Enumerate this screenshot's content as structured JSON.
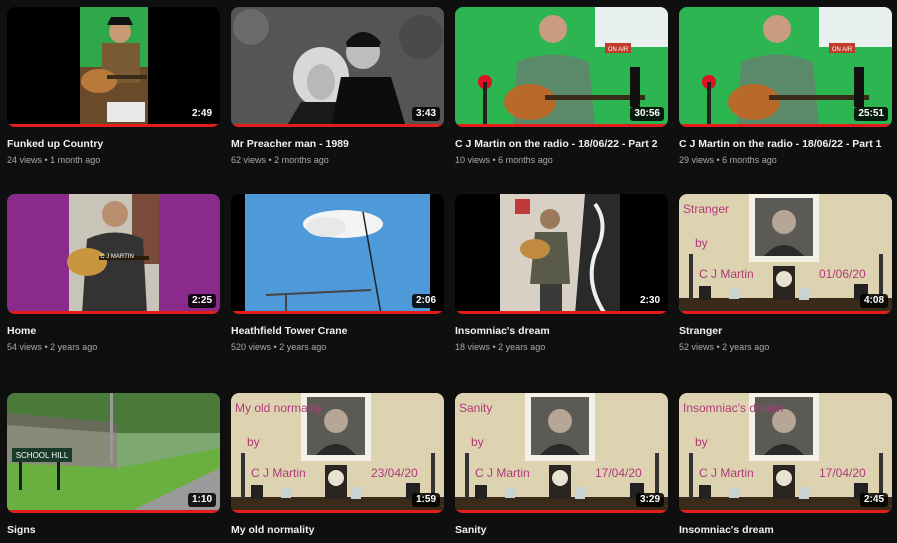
{
  "videos": [
    {
      "title": "Funked up Country",
      "views": "24 views",
      "age": "1 month ago",
      "duration": "2:49"
    },
    {
      "title": "Mr Preacher man - 1989",
      "views": "62 views",
      "age": "2 months ago",
      "duration": "3:43"
    },
    {
      "title": "C J Martin on the radio - 18/06/22 - Part 2",
      "views": "10 views",
      "age": "6 months ago",
      "duration": "30:56"
    },
    {
      "title": "C J Martin on the radio - 18/06/22 - Part 1",
      "views": "29 views",
      "age": "6 months ago",
      "duration": "25:51"
    },
    {
      "title": "Home",
      "views": "54 views",
      "age": "2 years ago",
      "duration": "2:25"
    },
    {
      "title": "Heathfield Tower Crane",
      "views": "520 views",
      "age": "2 years ago",
      "duration": "2:06"
    },
    {
      "title": "Insomniac's dream",
      "views": "18 views",
      "age": "2 years ago",
      "duration": "2:30"
    },
    {
      "title": "Stranger",
      "views": "52 views",
      "age": "2 years ago",
      "duration": "4:08"
    },
    {
      "title": "Signs",
      "views": "",
      "age": "",
      "duration": "1:10"
    },
    {
      "title": "My old normality",
      "views": "",
      "age": "",
      "duration": "1:59"
    },
    {
      "title": "Sanity",
      "views": "",
      "age": "",
      "duration": "3:29"
    },
    {
      "title": "Insomniac's dream",
      "views": "",
      "age": "",
      "duration": "2:45"
    }
  ],
  "thumb_text": {
    "t3": "ON AIR",
    "t4": "ON AIR",
    "t5": "C J MARTIN",
    "t8": {
      "title": "Stranger",
      "by": "by",
      "name": "C J Martin",
      "date": "01/06/20"
    },
    "t9": "SCHOOL HILL",
    "t10": {
      "title": "My old normality",
      "by": "by",
      "name": "C J Martin",
      "date": "23/04/20"
    },
    "t11": {
      "title": "Sanity",
      "by": "by",
      "name": "C J Martin",
      "date": "17/04/20"
    },
    "t12": {
      "title": "Insomniac's dream",
      "by": "by",
      "name": "C J Martin",
      "date": "17/04/20"
    }
  },
  "meta_separator": " • ",
  "colors": {
    "background": "#0f0f0f",
    "progress": "#e51c1c",
    "meta": "#aaaaaa"
  }
}
